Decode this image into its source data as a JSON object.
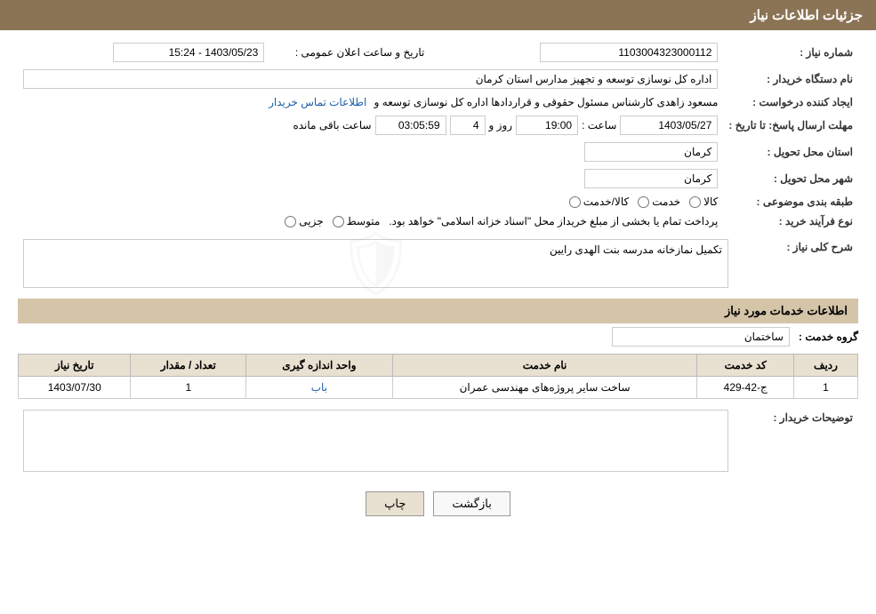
{
  "header": {
    "title": "جزئیات اطلاعات نیاز"
  },
  "fields": {
    "shomara_niaz_label": "شماره نیاز :",
    "shomara_niaz_value": "1103004323000112",
    "tarikh_label": "تاریخ و ساعت اعلان عمومی :",
    "tarikh_value": "1403/05/23 - 15:24",
    "nam_dastgah_label": "نام دستگاه خریدار :",
    "nam_dastgah_value": "اداره کل نوسازی  توسعه و تجهیز مدارس استان کرمان",
    "ijad_label": "ایجاد کننده درخواست :",
    "ijad_value": "مسعود زاهدی کارشناس مسئول حقوقی و قراردادها اداره کل نوسازی  توسعه و",
    "ettelaat_tamas_label": "اطلاعات تماس خریدار",
    "mohlat_label": "مهلت ارسال پاسخ: تا تاریخ :",
    "mohlat_date": "1403/05/27",
    "mohlat_time_label": "ساعت :",
    "mohlat_time": "19:00",
    "mohlat_roz_label": "روز و",
    "mohlat_roz_value": "4",
    "mohlat_remaining_label": "ساعت باقی مانده",
    "mohlat_remaining_value": "03:05:59",
    "ostan_tahvil_label": "استان محل تحویل :",
    "ostan_tahvil_value": "کرمان",
    "shahr_tahvil_label": "شهر محل تحویل :",
    "shahr_tahvil_value": "کرمان",
    "tabaqe_label": "طبقه بندی موضوعی :",
    "tabaqe_kala": "کالا",
    "tabaqe_khedmat": "خدمت",
    "tabaqe_kala_khedmat": "کالا/خدمت",
    "navae_farayand_label": "نوع فرآیند خرید :",
    "navae_jozi": "جزیی",
    "navae_motavaset": "متوسط",
    "navae_description": "پرداخت تمام یا بخشی از مبلغ خریداز محل \"اسناد خزانه اسلامی\" خواهد بود.",
    "sharh_label": "شرح کلی نیاز :",
    "sharh_value": "تکمیل نمازخانه مدرسه بنت الهدی رایین",
    "services_header": "اطلاعات خدمات مورد نیاز",
    "group_service_label": "گروه خدمت :",
    "group_service_value": "ساختمان",
    "table_headers": {
      "radif": "ردیف",
      "kod_khedmat": "کد خدمت",
      "nam_khedmat": "نام خدمت",
      "vahed": "واحد اندازه گیری",
      "tedad": "تعداد / مقدار",
      "tarikh_niaz": "تاریخ نیاز"
    },
    "table_rows": [
      {
        "radif": "1",
        "kod_khedmat": "ج-42-429",
        "nam_khedmat": "ساخت سایر پروژه‌های مهندسی عمران",
        "vahed": "باب",
        "tedad": "1",
        "tarikh_niaz": "1403/07/30"
      }
    ],
    "tosifat_label": "توضیحات خریدار :",
    "buttons": {
      "chap": "چاپ",
      "bazgasht": "بازگشت"
    }
  }
}
